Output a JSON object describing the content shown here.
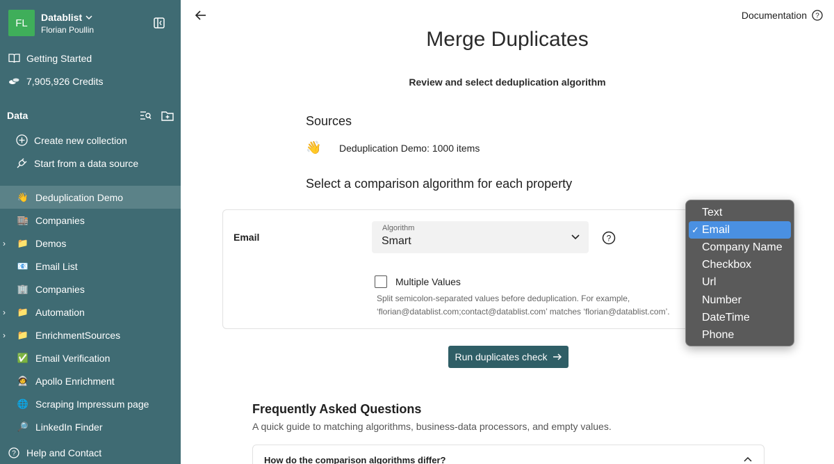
{
  "workspace": {
    "initials": "FL",
    "name": "Datablist",
    "user": "Florian Poullin"
  },
  "sidebar": {
    "top_links": [
      {
        "label": "Getting Started",
        "icon": "book-icon"
      },
      {
        "label": "7,905,926 Credits",
        "icon": "coins-icon"
      }
    ],
    "data_heading": "Data",
    "actions": [
      {
        "label": "Create new collection",
        "icon": "plus-circle-icon"
      },
      {
        "label": "Start from a data source",
        "icon": "plug-icon"
      }
    ],
    "collections": [
      {
        "label": "Deduplication Demo",
        "emoji": "👋",
        "active": true,
        "expandable": false
      },
      {
        "label": "Companies",
        "emoji": "🏬",
        "active": false,
        "expandable": false
      },
      {
        "label": "Demos",
        "emoji": "📁",
        "active": false,
        "expandable": true
      },
      {
        "label": "Email List",
        "emoji": "📧",
        "active": false,
        "expandable": false
      },
      {
        "label": "Companies",
        "emoji": "🏢",
        "active": false,
        "expandable": false
      },
      {
        "label": "Automation",
        "emoji": "📁",
        "active": false,
        "expandable": true
      },
      {
        "label": "EnrichmentSources",
        "emoji": "📁",
        "active": false,
        "expandable": true
      },
      {
        "label": "Email Verification",
        "emoji": "✅",
        "active": false,
        "expandable": false
      },
      {
        "label": "Apollo Enrichment",
        "emoji": "🧑‍🚀",
        "active": false,
        "expandable": false
      },
      {
        "label": "Scraping Impressum page",
        "emoji": "🌐",
        "active": false,
        "expandable": false
      },
      {
        "label": "LinkedIn Finder",
        "emoji": "🔎",
        "active": false,
        "expandable": false
      }
    ],
    "help_label": "Help and Contact"
  },
  "header": {
    "documentation_label": "Documentation"
  },
  "main": {
    "title": "Merge Duplicates",
    "subtitle": "Review and select deduplication algorithm",
    "sources_heading": "Sources",
    "source": {
      "emoji": "👋",
      "label": "Deduplication Demo: 1000 items"
    },
    "algorithm_heading": "Select a comparison algorithm for each property",
    "property": {
      "name": "Email",
      "algorithm_label": "Algorithm",
      "algorithm_value": "Smart",
      "multiple_values_label": "Multiple Values",
      "multiple_values_checked": false,
      "multiple_values_help": "Split semicolon-separated values before deduplication. For example, ‘florian@datablist.com;contact@datablist.com’ matches ‘florian@datablist.com’."
    },
    "run_button_label": "Run duplicates check"
  },
  "faq": {
    "heading": "Frequently Asked Questions",
    "subheading": "A quick guide to matching algorithms, business-data processors, and empty values.",
    "first_question": "How do the comparison algorithms differ?"
  },
  "dropdown": {
    "selected": "Email",
    "options": [
      "Text",
      "Email",
      "Company Name",
      "Checkbox",
      "Url",
      "Number",
      "DateTime",
      "Phone"
    ]
  },
  "colors": {
    "sidebar_bg": "#3f6b73",
    "sidebar_active": "#5b8288",
    "avatar_bg": "#3fae5a",
    "primary_button": "#2f5e66",
    "dropdown_bg": "#5a5a5a",
    "dropdown_selected": "#4a90e2"
  }
}
